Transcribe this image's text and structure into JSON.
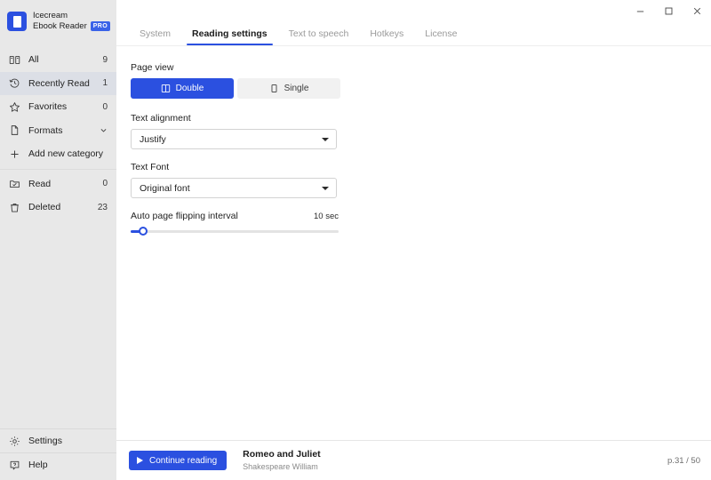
{
  "brand": {
    "line1": "Icecream",
    "line2": "Ebook Reader",
    "badge": "PRO",
    "logo_icon": "book-logo-icon"
  },
  "sidebar": {
    "items": [
      {
        "label": "All",
        "count": "9",
        "icon": "library-icon",
        "selected": false
      },
      {
        "label": "Recently Read",
        "count": "1",
        "icon": "history-icon",
        "selected": true
      },
      {
        "label": "Favorites",
        "count": "0",
        "icon": "star-icon",
        "selected": false
      },
      {
        "label": "Formats",
        "count": "",
        "icon": "file-icon",
        "selected": false
      },
      {
        "label": "Add new category",
        "count": "",
        "icon": "plus-icon",
        "selected": false
      }
    ],
    "items2": [
      {
        "label": "Read",
        "count": "0",
        "icon": "folder-check-icon",
        "selected": false
      },
      {
        "label": "Deleted",
        "count": "23",
        "icon": "trash-icon",
        "selected": false
      }
    ],
    "bottom": [
      {
        "label": "Settings",
        "icon": "gear-icon"
      },
      {
        "label": "Help",
        "icon": "help-icon"
      }
    ]
  },
  "window_controls": {
    "minimize": "minimize-icon",
    "maximize": "maximize-icon",
    "close": "close-icon"
  },
  "tabs": [
    {
      "label": "System",
      "active": false
    },
    {
      "label": "Reading settings",
      "active": true
    },
    {
      "label": "Text to speech",
      "active": false
    },
    {
      "label": "Hotkeys",
      "active": false
    },
    {
      "label": "License",
      "active": false
    }
  ],
  "settings": {
    "page_view": {
      "label": "Page view",
      "options": [
        {
          "label": "Double",
          "icon": "double-page-icon",
          "selected": true
        },
        {
          "label": "Single",
          "icon": "single-page-icon",
          "selected": false
        }
      ]
    },
    "text_alignment": {
      "label": "Text alignment",
      "value": "Justify"
    },
    "text_font": {
      "label": "Text Font",
      "value": "Original font"
    },
    "auto_flip": {
      "label": "Auto page flipping interval",
      "value": "10 sec",
      "percent": 4
    }
  },
  "bottombar": {
    "continue_label": "Continue reading",
    "book_title": "Romeo and Juliet",
    "book_author": "Shakespeare William",
    "page_indicator": "p.31 / 50"
  },
  "colors": {
    "accent": "#2b50e0",
    "sidebar_bg": "#e8e8e8",
    "selected_row": "#dcdfe6"
  }
}
